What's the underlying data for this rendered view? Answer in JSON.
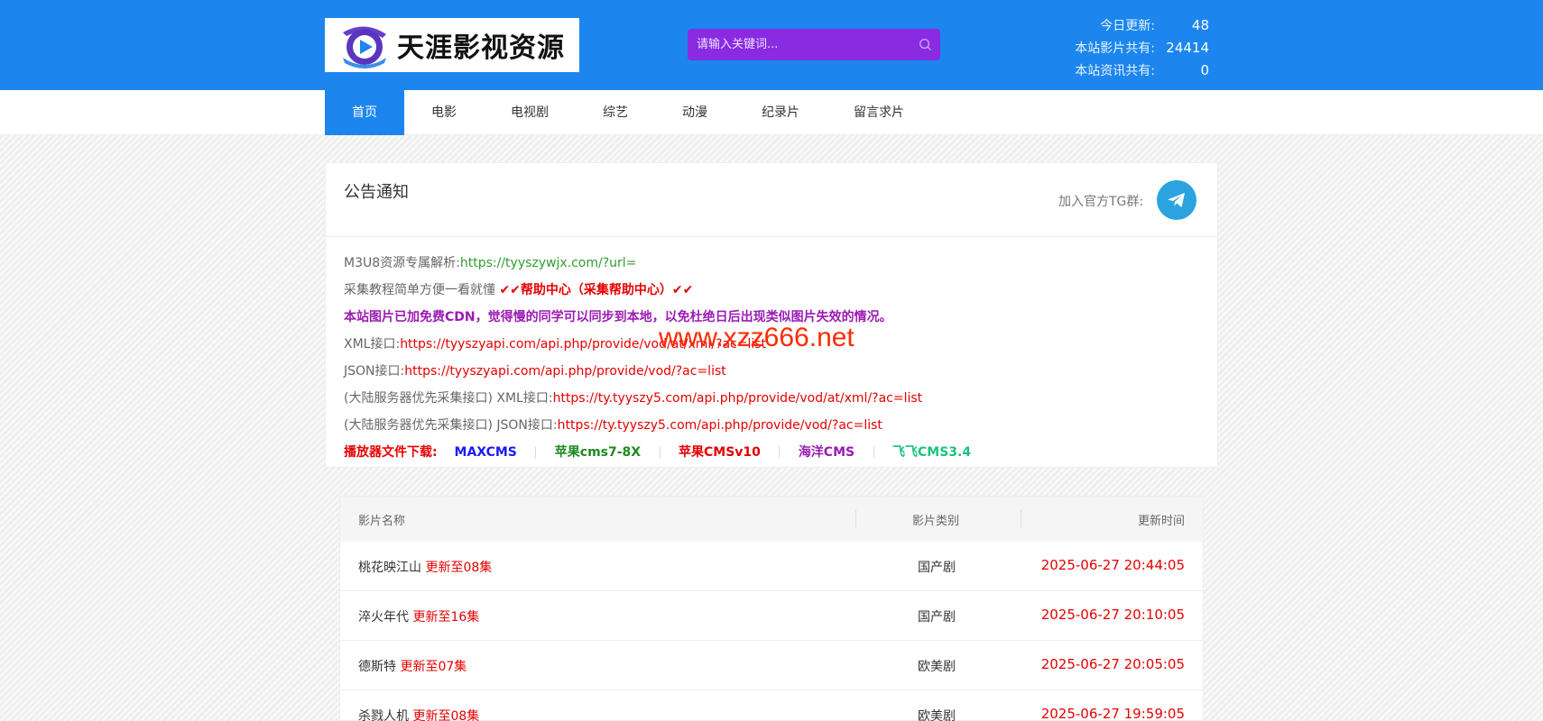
{
  "header": {
    "logo_text": "天涯影视资源",
    "search_placeholder": "请输入关键词...",
    "stats": [
      {
        "label": "今日更新:",
        "value": "48"
      },
      {
        "label": "本站影片共有:",
        "value": "24414"
      },
      {
        "label": "本站资讯共有:",
        "value": "0"
      }
    ],
    "colors": {
      "bar": "#1c86ee",
      "search": "#8a2be2"
    }
  },
  "nav": {
    "items": [
      {
        "label": "首页",
        "active": true
      },
      {
        "label": "电影"
      },
      {
        "label": "电视剧"
      },
      {
        "label": "综艺"
      },
      {
        "label": "动漫"
      },
      {
        "label": "纪录片"
      },
      {
        "label": "留言求片"
      }
    ]
  },
  "notice": {
    "title": "公告通知",
    "tg_label": "加入官方TG群:",
    "line1_label": "M3U8资源专属解析:",
    "line1_link": "https://tyyszywjx.com/?url=",
    "line2_label": "采集教程简单方便一看就懂",
    "line2_link": "✔✔帮助中心（采集帮助中心）✔✔",
    "line3": "本站图片已加免费CDN，觉得慢的同学可以同步到本地，以免杜绝日后出现类似图片失效的情况。",
    "xml_label": "XML接口:",
    "xml_link": "https://tyyszyapi.com/api.php/provide/vod/at/xml/?ac=list",
    "json_label": "JSON接口:",
    "json_link": "https://tyyszyapi.com/api.php/provide/vod/?ac=list",
    "cn_xml_label": "(大陆服务器优先采集接口) XML接口:",
    "cn_xml_link": "https://ty.tyyszy5.com/api.php/provide/vod/at/xml/?ac=list",
    "cn_json_label": "(大陆服务器优先采集接口) JSON接口:",
    "cn_json_link": "https://ty.tyyszy5.com/api.php/provide/vod/?ac=list",
    "download_label": "播放器文件下载:",
    "downloads": [
      {
        "label": "MAXCMS",
        "color": "#1a1aff"
      },
      {
        "label": "苹果cms7-8X",
        "color": "#1e8a1e"
      },
      {
        "label": "苹果CMSv10",
        "color": "#e60000"
      },
      {
        "label": "海洋CMS",
        "color": "#9b1bb4"
      },
      {
        "label": "飞飞CMS3.4",
        "color": "#19c37d"
      }
    ],
    "watermark": "www.xzz666.net"
  },
  "table": {
    "headers": {
      "name": "影片名称",
      "type": "影片类别",
      "time": "更新时间"
    },
    "rows": [
      {
        "name": "桃花映江山",
        "ep": "更新至08集",
        "type": "国产剧",
        "time": "2025-06-27 20:44:05"
      },
      {
        "name": "淬火年代",
        "ep": "更新至16集",
        "type": "国产剧",
        "time": "2025-06-27 20:10:05"
      },
      {
        "name": "德斯特",
        "ep": "更新至07集",
        "type": "欧美剧",
        "time": "2025-06-27 20:05:05"
      },
      {
        "name": "杀戮人机",
        "ep": "更新至08集",
        "type": "欧美剧",
        "time": "2025-06-27 19:59:05"
      }
    ]
  }
}
